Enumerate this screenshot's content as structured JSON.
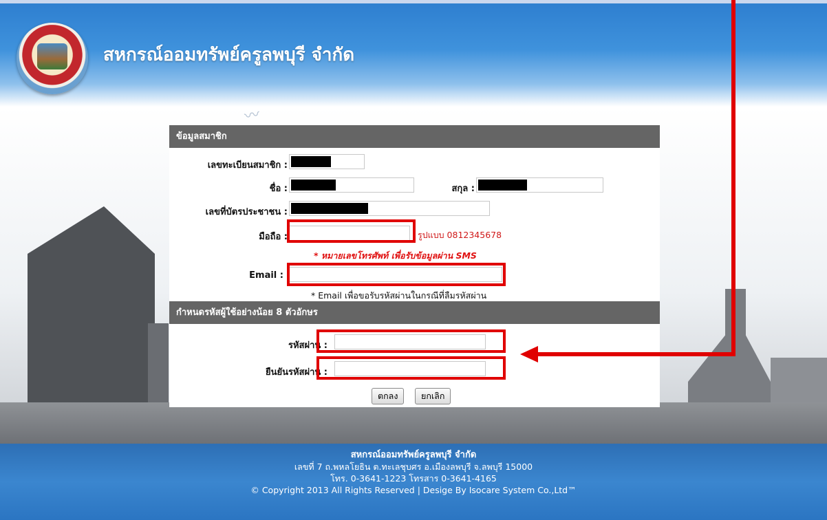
{
  "site": {
    "title": "สหกรณ์ออมทรัพย์ครูลพบุรี จำกัด"
  },
  "member_section": {
    "heading": "ข้อมูลสมาชิก",
    "member_id_label": "เลขทะเบียนสมาชิก :",
    "first_name_label": "ชื่อ :",
    "last_name_label": "สกุล :",
    "id_card_label": "เลขที่บัตรประชาชน :",
    "mobile_label": "มือถือ :",
    "mobile_format_hint": "รูปแบบ 0812345678",
    "mobile_note": "* หมายเลขโทรศัพท์ เพื่อรับข้อมูลผ่าน SMS",
    "email_label": "Email :",
    "email_note": "* Email เพื่อขอรับรหัสผ่านในกรณีที่ลืมรหัสผ่าน"
  },
  "password_section": {
    "heading": "กำหนดรหัสผู้ใช้อย่างน้อย 8 ตัวอักษร",
    "password_label": "รหัสผ่าน :",
    "confirm_label": "ยืนยันรหัสผ่าน :"
  },
  "buttons": {
    "ok": "ตกลง",
    "cancel": "ยกเลิก"
  },
  "footer": {
    "line1": "สหกรณ์ออมทรัพย์ครูลพบุรี จำกัด",
    "line2": "เลขที่ 7 ถ.พหลโยธิน ต.ทะเลชุบศร อ.เมืองลพบุรี จ.ลพบุรี 15000",
    "line3": "โทร. 0-3641-1223 โทรสาร 0-3641-4165",
    "line4": "© Copyright 2013 All Rights Reserved | Desige By Isocare System Co.,Ltd™"
  },
  "colors": {
    "header_blue": "#3f92dc",
    "section_gray": "#656565",
    "annotation_red": "#e00000"
  }
}
